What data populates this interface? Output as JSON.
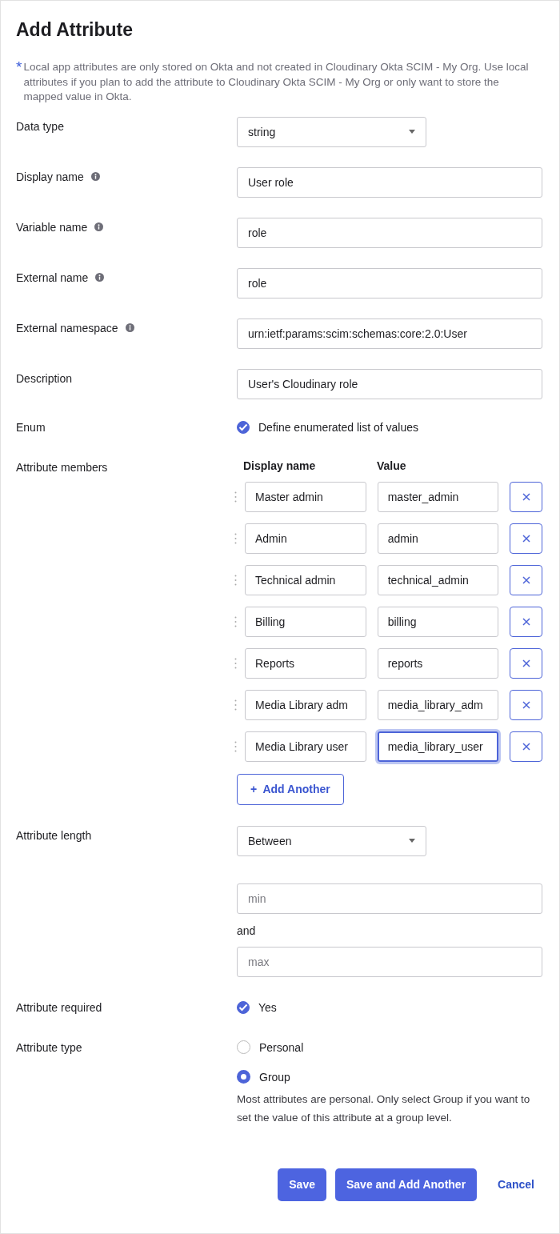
{
  "title": "Add Attribute",
  "note": {
    "marker": "*",
    "text": "Local app attributes are only stored on Okta and not created in Cloudinary Okta SCIM - My Org. Use local attributes if you plan to add the attribute to Cloudinary Okta SCIM - My Org or only want to store the mapped value in Okta."
  },
  "data_type": {
    "label": "Data type",
    "value": "string"
  },
  "text_fields": [
    {
      "label": "Display name",
      "info": true,
      "value": "User role"
    },
    {
      "label": "Variable name",
      "info": true,
      "value": "role"
    },
    {
      "label": "External name",
      "info": true,
      "value": "role"
    },
    {
      "label": "External namespace",
      "info": true,
      "value": "urn:ietf:params:scim:schemas:core:2.0:User"
    },
    {
      "label": "Description",
      "info": false,
      "value": "User's Cloudinary role"
    }
  ],
  "enum": {
    "label": "Enum",
    "checked": true,
    "option": "Define enumerated list of values"
  },
  "members": {
    "label": "Attribute members",
    "columns": [
      "Display name",
      "Value"
    ],
    "rows": [
      {
        "display": "Master admin",
        "value": "master_admin",
        "focused": false
      },
      {
        "display": "Admin",
        "value": "admin",
        "focused": false
      },
      {
        "display": "Technical admin",
        "value": "technical_admin",
        "focused": false
      },
      {
        "display": "Billing",
        "value": "billing",
        "focused": false
      },
      {
        "display": "Reports",
        "value": "reports",
        "focused": false
      },
      {
        "display": "Media Library adm",
        "value": "media_library_adm",
        "focused": false
      },
      {
        "display": "Media Library user",
        "value": "media_library_user",
        "focused": true
      }
    ],
    "add_button": {
      "icon": "+",
      "label": "Add Another"
    }
  },
  "length": {
    "label": "Attribute length",
    "value": "Between",
    "min_placeholder": "min",
    "joiner": "and",
    "max_placeholder": "max"
  },
  "required": {
    "label": "Attribute required",
    "checked": true,
    "option": "Yes"
  },
  "type": {
    "label": "Attribute type",
    "options": [
      {
        "label": "Personal",
        "selected": false
      },
      {
        "label": "Group",
        "selected": true
      }
    ],
    "help": "Most attributes are personal. Only select Group if you want to set the value of this attribute at a group level."
  },
  "buttons": [
    {
      "kind": "primary",
      "label": "Save"
    },
    {
      "kind": "primary",
      "label": "Save and Add Another"
    },
    {
      "kind": "link",
      "label": "Cancel"
    }
  ]
}
